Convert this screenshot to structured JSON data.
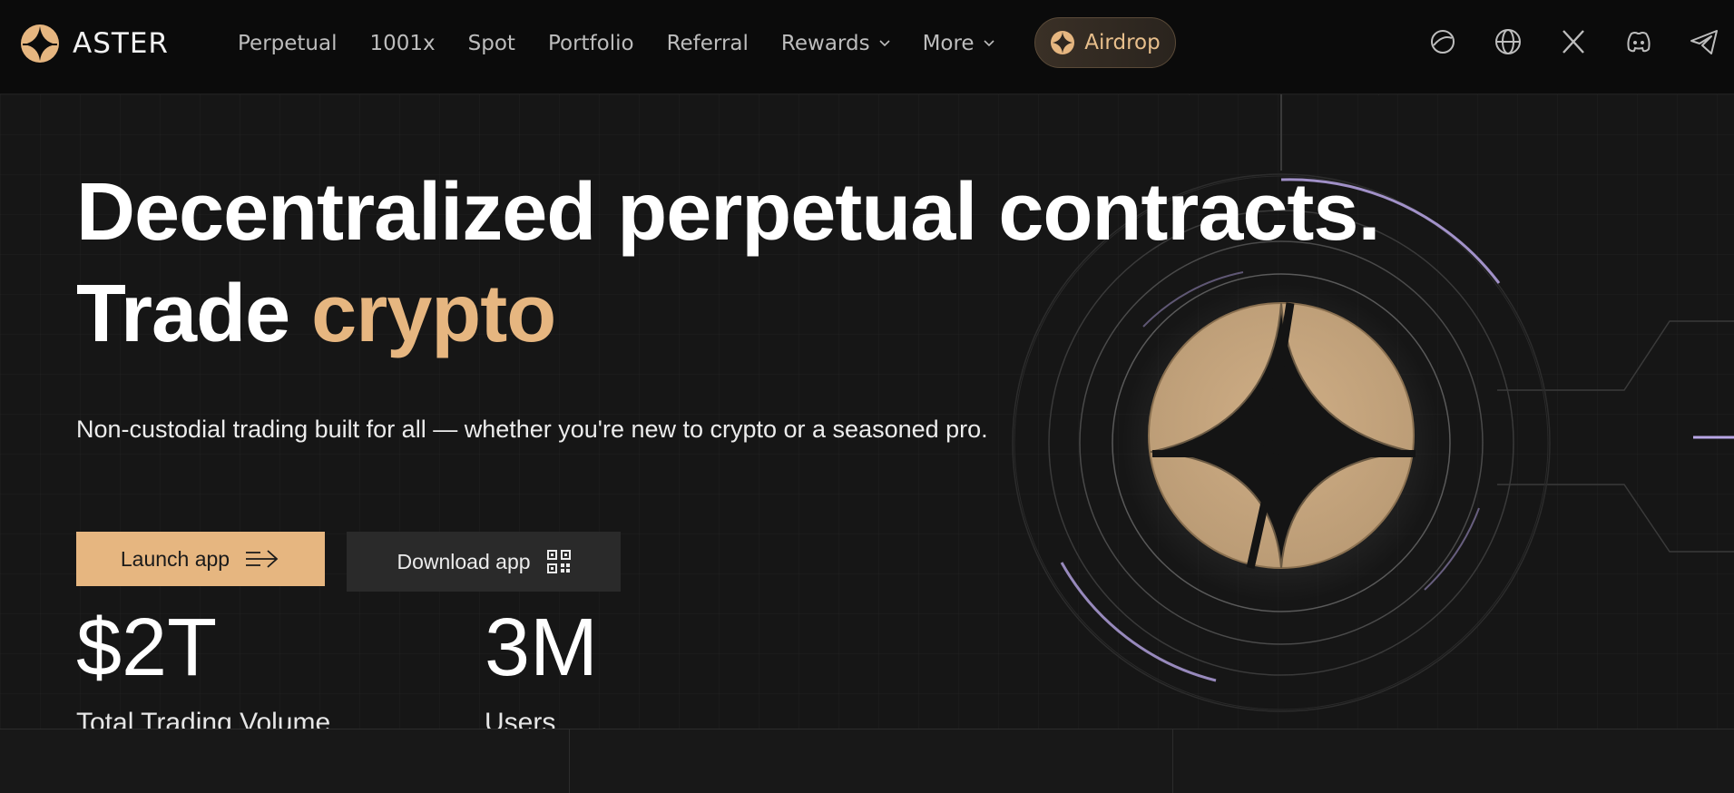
{
  "brand": {
    "name": "ASTER",
    "accent_color": "#e6b680"
  },
  "nav": {
    "links": [
      {
        "label": "Perpetual"
      },
      {
        "label": "1001x"
      },
      {
        "label": "Spot"
      },
      {
        "label": "Portfolio"
      },
      {
        "label": "Referral"
      },
      {
        "label": "Rewards",
        "dropdown": true
      },
      {
        "label": "More",
        "dropdown": true
      }
    ],
    "airdrop_label": "Airdrop",
    "social_icons": [
      "theme-toggle-icon",
      "globe-icon",
      "x-twitter-icon",
      "discord-icon",
      "telegram-icon"
    ]
  },
  "hero": {
    "headline_line1": "Decentralized perpetual contracts.",
    "headline_line2_prefix": "Trade",
    "headline_line2_accent": "crypto",
    "subtitle": "Non-custodial trading built for all — whether you're new to crypto or a seasoned pro.",
    "launch_button": "Launch app",
    "download_button": "Download app"
  },
  "stats": [
    {
      "value": "$2T",
      "label": "Total Trading Volume"
    },
    {
      "value": "3M",
      "label": "Users"
    }
  ]
}
